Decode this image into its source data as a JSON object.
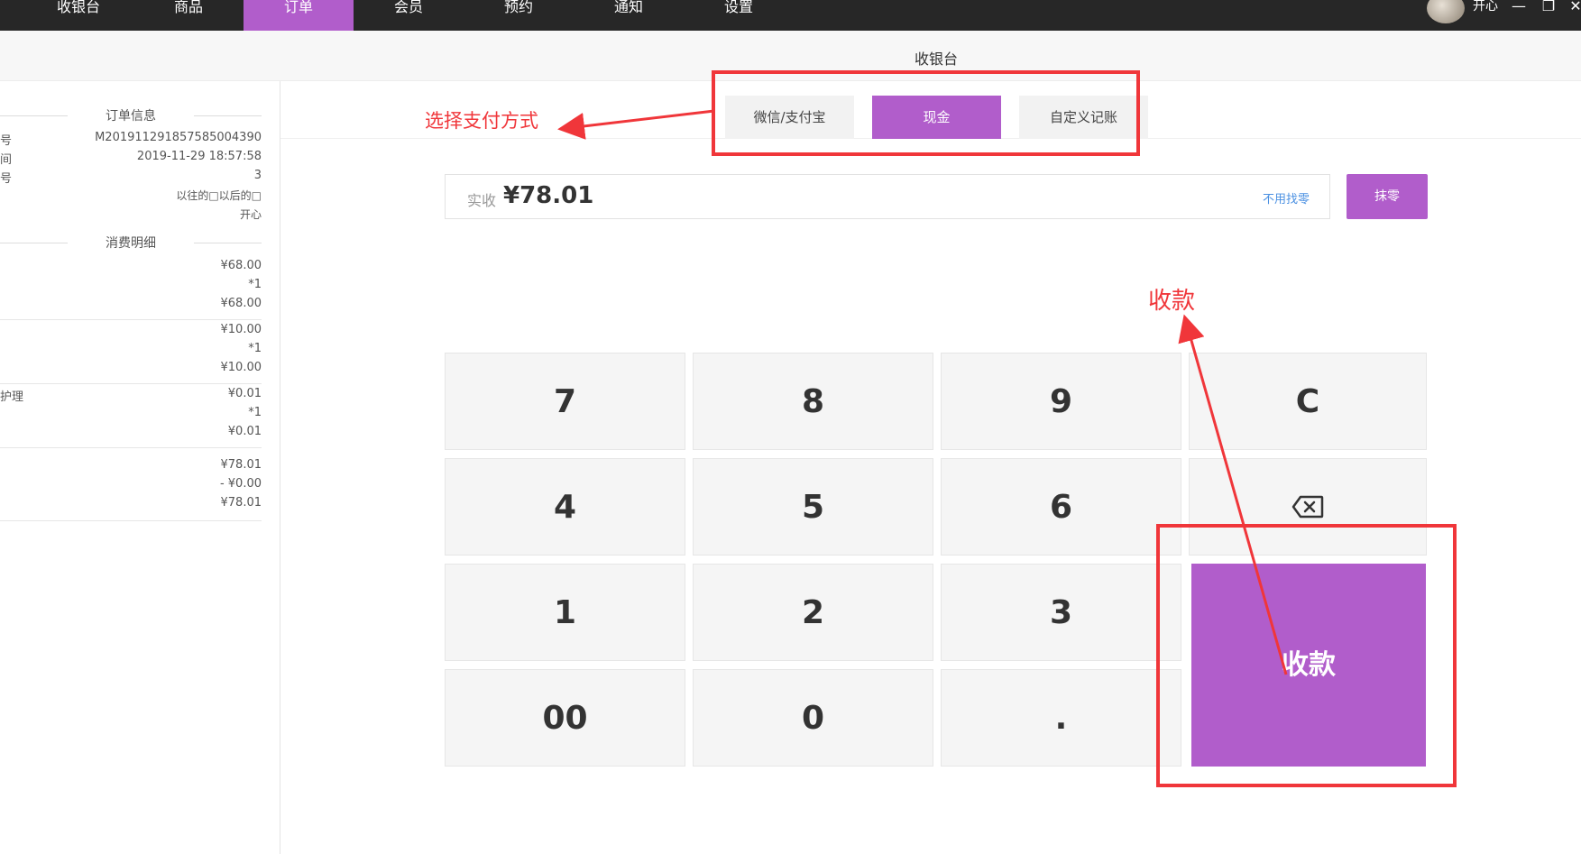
{
  "nav": {
    "items": [
      {
        "label": "收银台"
      },
      {
        "label": "商品"
      },
      {
        "label": "订单"
      },
      {
        "label": "会员"
      },
      {
        "label": "预约"
      },
      {
        "label": "通知"
      },
      {
        "label": "设置"
      }
    ],
    "active_index": 2,
    "username": "开心",
    "window_controls": {
      "minimize": "—",
      "restore": "❐",
      "close": "✕"
    }
  },
  "subheader": {
    "title": "收银台"
  },
  "order_info": {
    "title": "订单信息",
    "rows": [
      {
        "label": "号",
        "value": "M201911291857585004390"
      },
      {
        "label": "间",
        "value": "2019-11-29 18:57:58"
      },
      {
        "label": "号",
        "value": "3"
      },
      {
        "label": "",
        "value": "以往的□以后的□"
      },
      {
        "label": "",
        "value": "开心"
      }
    ]
  },
  "consumption": {
    "title": "消费明细",
    "items": [
      {
        "name": "",
        "price": "¥68.00",
        "qty": "*1",
        "subtotal": "¥68.00"
      },
      {
        "name": "",
        "price": "¥10.00",
        "qty": "*1",
        "subtotal": "¥10.00"
      },
      {
        "name": "护理",
        "price": "¥0.01",
        "qty": "*1",
        "subtotal": "¥0.01"
      }
    ],
    "summary": {
      "total": "¥78.01",
      "discount": "- ¥0.00",
      "payable": "¥78.01"
    }
  },
  "payment": {
    "methods": [
      {
        "label": "微信/支付宝"
      },
      {
        "label": "现金"
      },
      {
        "label": "自定义记账"
      }
    ],
    "active_index": 1,
    "amount_label": "实收",
    "amount_value": "¥78.01",
    "no_change_label": "不用找零",
    "round_button": "抹零"
  },
  "keypad": {
    "keys": [
      "7",
      "8",
      "9",
      "C",
      "4",
      "5",
      "6",
      "1",
      "2",
      "3",
      "00",
      "0",
      "."
    ],
    "backspace_icon": "backspace-icon",
    "collect_label": "收款"
  },
  "annotations": {
    "choose_payment": "选择支付方式",
    "collect": "收款",
    "color": "#f0363a"
  },
  "colors": {
    "accent": "#b15dcb",
    "topbar": "#272727"
  }
}
